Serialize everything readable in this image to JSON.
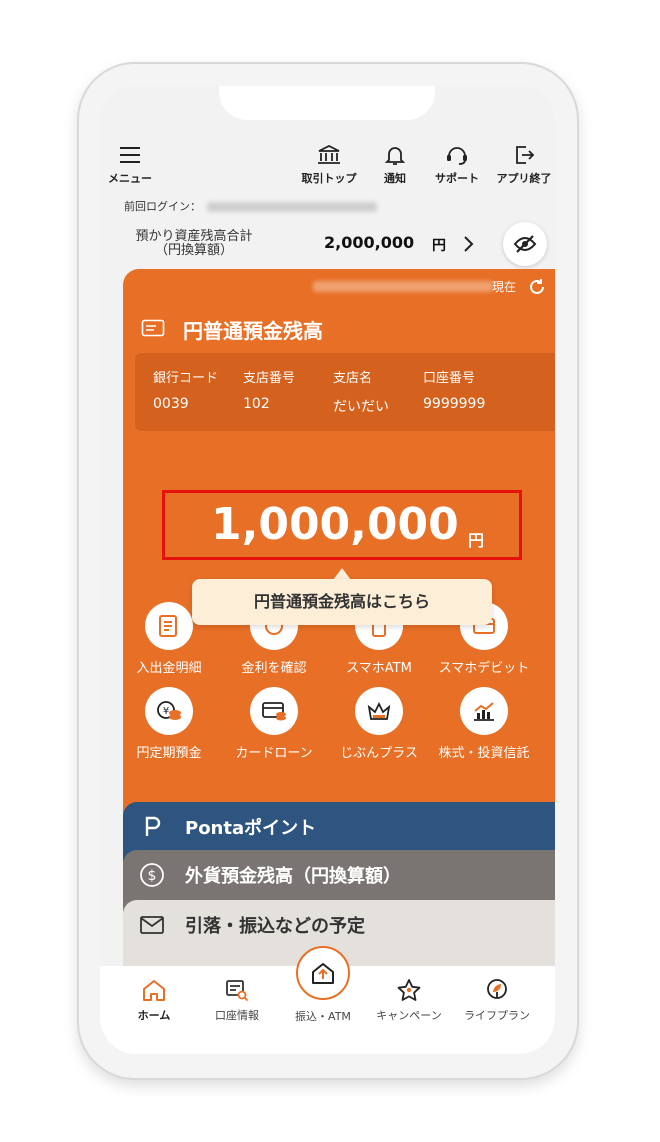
{
  "colors": {
    "accent": "#e86f26",
    "ponta": "#2e5480",
    "fx": "#7a7572",
    "highlight": "#e3120b",
    "tooltip_bg": "#fdeed8"
  },
  "header": {
    "menu": "メニュー",
    "bank_top": "取引トップ",
    "notify": "通知",
    "support": "サポート",
    "app_exit": "アプリ終了"
  },
  "last_login": {
    "label": "前回ログイン："
  },
  "assets": {
    "label_line1": "預かり資産残高合計",
    "label_line2": "（円換算額）",
    "amount": "2,000,000",
    "unit": "円"
  },
  "card": {
    "now_label": "現在",
    "title": "円普通預金残高",
    "account": {
      "bank_code_label": "銀行コード",
      "bank_code": "0039",
      "branch_no_label": "支店番号",
      "branch_no": "102",
      "branch_name_label": "支店名",
      "branch_name": "だいだい",
      "account_no_label": "口座番号",
      "account_no": "9999999"
    },
    "balance": "1,000,000",
    "balance_unit": "円",
    "tooltip": "円普通預金残高はこちら"
  },
  "actions": [
    {
      "label": "入出金明細",
      "icon": "statement-icon"
    },
    {
      "label": "金利を確認",
      "icon": "interest-icon"
    },
    {
      "label": "スマホATM",
      "icon": "phone-atm-icon"
    },
    {
      "label": "スマホデビット",
      "icon": "debit-card-icon"
    },
    {
      "label": "円定期預金",
      "icon": "yen-coins-icon"
    },
    {
      "label": "カードローン",
      "icon": "card-loan-icon"
    },
    {
      "label": "じぶんプラス",
      "icon": "crown-icon"
    },
    {
      "label": "株式・投資信託",
      "icon": "stock-chart-icon"
    }
  ],
  "stacked_cards": {
    "ponta": "Pontaポイント",
    "fx": "外貨預金残高（円換算額）",
    "schedule": "引落・振込などの予定"
  },
  "bottom_nav": {
    "home": "ホーム",
    "account_info": "口座情報",
    "transfer": "振込・ATM",
    "campaign": "キャンペーン",
    "life_plan": "ライフプラン"
  }
}
